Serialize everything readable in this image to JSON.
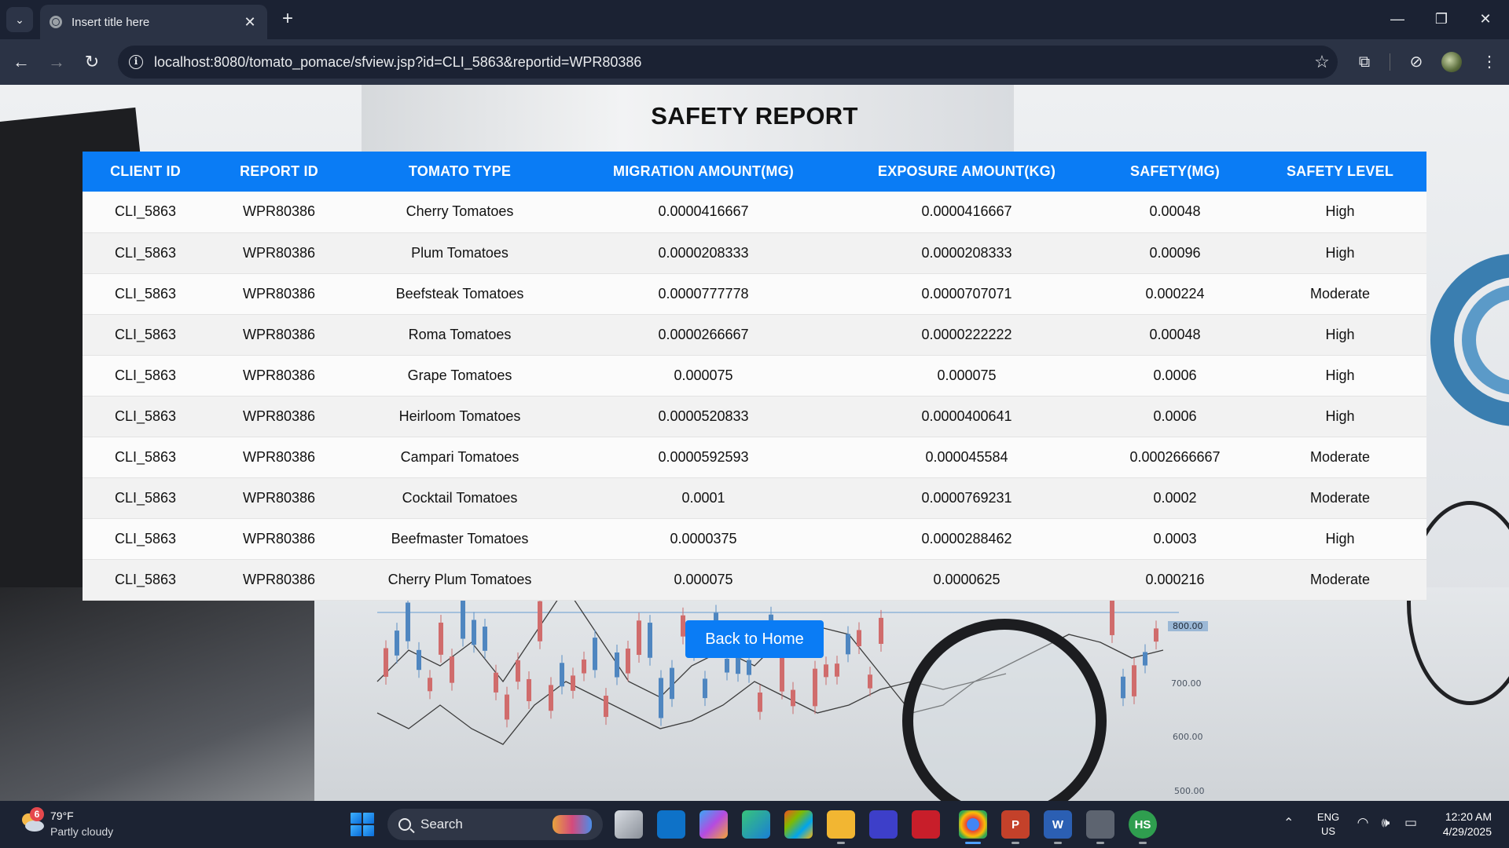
{
  "browser": {
    "tab_title": "Insert title here",
    "tab_close": "✕",
    "new_tab": "+",
    "url": "localhost:8080/tomato_pomace/sfview.jsp?id=CLI_5863&reportid=WPR80386",
    "window_controls": {
      "minimize": "—",
      "maximize": "❐",
      "close": "✕"
    },
    "icons": {
      "tab_list": "chevron-down-icon",
      "back": "arrow-left-icon",
      "forward": "arrow-right-icon",
      "reload": "reload-icon",
      "site_info": "info-icon",
      "bookmark": "star-icon",
      "extensions": "puzzle-icon",
      "performance": "gauge-icon",
      "profile": "avatar",
      "menu": "kebab-menu-icon"
    },
    "glyphs": {
      "back": "←",
      "forward": "→",
      "reload": "↻",
      "info": "i",
      "star": "☆",
      "extensions": "⧉",
      "performance": "⊘",
      "menu": "⋮",
      "tab_list": "⌄"
    }
  },
  "page": {
    "title": "SAFETY REPORT",
    "table": {
      "headers": [
        "CLIENT ID",
        "REPORT ID",
        "TOMATO TYPE",
        "MIGRATION AMOUNT(MG)",
        "EXPOSURE AMOUNT(KG)",
        "SAFETY(MG)",
        "SAFETY LEVEL"
      ],
      "rows": [
        [
          "CLI_5863",
          "WPR80386",
          "Cherry Tomatoes",
          "0.0000416667",
          "0.0000416667",
          "0.00048",
          "High"
        ],
        [
          "CLI_5863",
          "WPR80386",
          "Plum Tomatoes",
          "0.0000208333",
          "0.0000208333",
          "0.00096",
          "High"
        ],
        [
          "CLI_5863",
          "WPR80386",
          "Beefsteak Tomatoes",
          "0.0000777778",
          "0.0000707071",
          "0.000224",
          "Moderate"
        ],
        [
          "CLI_5863",
          "WPR80386",
          "Roma Tomatoes",
          "0.0000266667",
          "0.0000222222",
          "0.00048",
          "High"
        ],
        [
          "CLI_5863",
          "WPR80386",
          "Grape Tomatoes",
          "0.000075",
          "0.000075",
          "0.0006",
          "High"
        ],
        [
          "CLI_5863",
          "WPR80386",
          "Heirloom Tomatoes",
          "0.0000520833",
          "0.0000400641",
          "0.0006",
          "High"
        ],
        [
          "CLI_5863",
          "WPR80386",
          "Campari Tomatoes",
          "0.0000592593",
          "0.000045584",
          "0.0002666667",
          "Moderate"
        ],
        [
          "CLI_5863",
          "WPR80386",
          "Cocktail Tomatoes",
          "0.0001",
          "0.0000769231",
          "0.0002",
          "Moderate"
        ],
        [
          "CLI_5863",
          "WPR80386",
          "Beefmaster Tomatoes",
          "0.0000375",
          "0.0000288462",
          "0.0003",
          "High"
        ],
        [
          "CLI_5863",
          "WPR80386",
          "Cherry Plum Tomatoes",
          "0.000075",
          "0.0000625",
          "0.000216",
          "Moderate"
        ]
      ]
    },
    "back_button": "Back to Home",
    "background_axis_labels": [
      "800.00",
      "700.00",
      "600.00",
      "500.00"
    ],
    "colors": {
      "accent": "#0a7cf5",
      "header_text": "#ffffff"
    }
  },
  "taskbar": {
    "weather": {
      "badge": "6",
      "temp": "79°F",
      "desc": "Partly cloudy"
    },
    "search_placeholder": "Search",
    "apps": [
      {
        "name": "task-view-icon",
        "label": ""
      },
      {
        "name": "vscode-icon",
        "label": ""
      },
      {
        "name": "copilot-icon",
        "label": ""
      },
      {
        "name": "edge-icon",
        "label": ""
      },
      {
        "name": "store-icon",
        "label": ""
      },
      {
        "name": "file-explorer-icon",
        "label": ""
      },
      {
        "name": "mathtype-icon",
        "label": ""
      },
      {
        "name": "mcafee-icon",
        "label": ""
      },
      {
        "name": "chrome-icon",
        "label": ""
      },
      {
        "name": "powerpoint-icon",
        "label": "P"
      },
      {
        "name": "word-icon",
        "label": "W"
      },
      {
        "name": "settings-icon",
        "label": ""
      },
      {
        "name": "hs-app-icon",
        "label": "HS"
      }
    ],
    "language": {
      "line1": "ENG",
      "line2": "US"
    },
    "clock": {
      "time": "12:20 AM",
      "date": "4/29/2025"
    }
  }
}
